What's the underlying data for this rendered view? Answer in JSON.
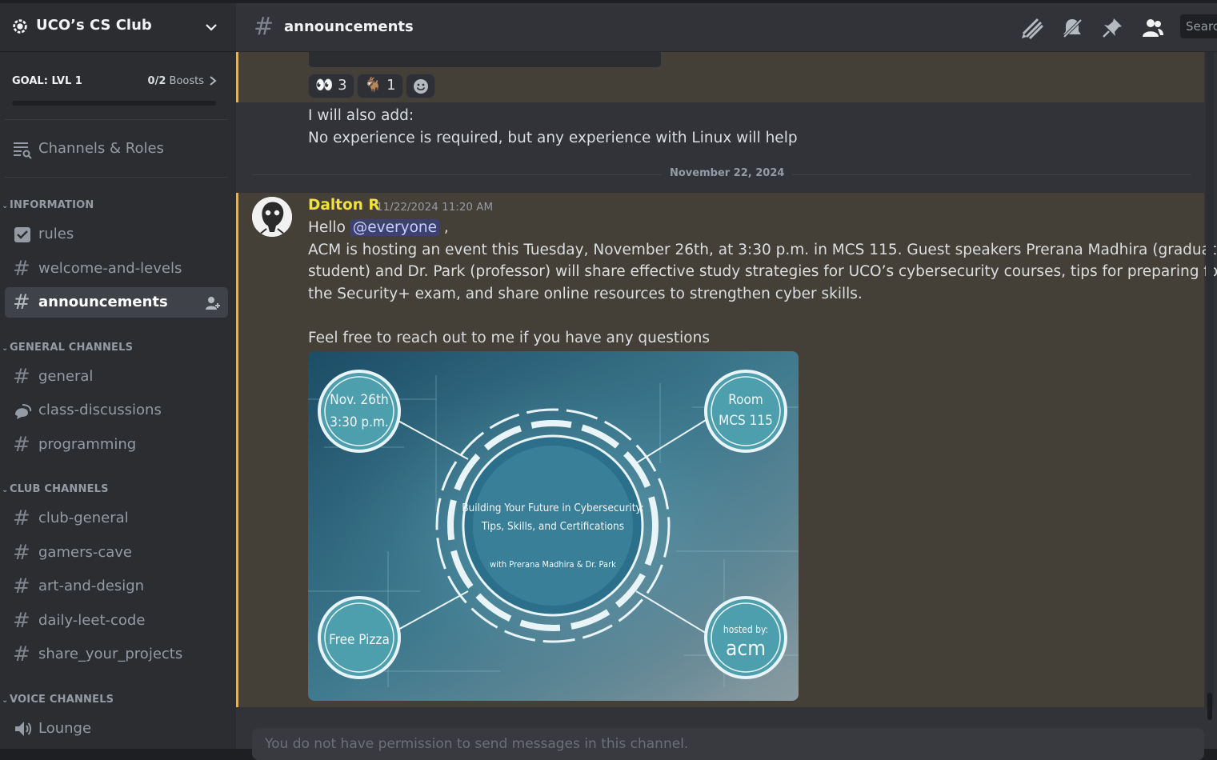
{
  "server": {
    "name": "UCO’s CS Club",
    "goal_label": "GOAL: LVL 1",
    "boosts_count": "0/2",
    "boosts_label": "Boosts",
    "progress": 0
  },
  "sidebar": {
    "channels_roles": "Channels & Roles",
    "categories": [
      {
        "label": "INFORMATION",
        "channels": [
          {
            "name": "rules",
            "icon": "rules-icon"
          },
          {
            "name": "welcome-and-levels",
            "icon": "hash-icon"
          },
          {
            "name": "announcements",
            "icon": "hash-icon",
            "active": true
          }
        ]
      },
      {
        "label": "GENERAL CHANNELS",
        "channels": [
          {
            "name": "general",
            "icon": "hash-icon"
          },
          {
            "name": "class-discussions",
            "icon": "forum-icon"
          },
          {
            "name": "programming",
            "icon": "hash-icon"
          }
        ]
      },
      {
        "label": "CLUB CHANNELS",
        "channels": [
          {
            "name": "club-general",
            "icon": "hash-icon"
          },
          {
            "name": "gamers-cave",
            "icon": "hash-icon"
          },
          {
            "name": "art-and-design",
            "icon": "hash-icon"
          },
          {
            "name": "daily-leet-code",
            "icon": "hash-icon"
          },
          {
            "name": "share_your_projects",
            "icon": "hash-icon"
          }
        ]
      },
      {
        "label": "VOICE CHANNELS",
        "channels": [
          {
            "name": "Lounge",
            "icon": "speaker-icon"
          }
        ]
      }
    ]
  },
  "header": {
    "channel": "announcements",
    "search_placeholder": "Search"
  },
  "messages": {
    "reactions": [
      {
        "emoji": "eyes",
        "count": "3"
      },
      {
        "emoji": "goat",
        "count": "1"
      }
    ],
    "prev_lines": [
      "I will also add:",
      "No experience is required, but any experience with Linux will help"
    ],
    "date_divider": "November 22, 2024",
    "post": {
      "author": "Dalton R",
      "timestamp": "11/22/2024 11:20 AM",
      "hello": "Hello",
      "mention": "@everyone",
      "comma": " ,",
      "line1": "ACM is hosting an event this Tuesday, November 26th, at 3:30 p.m. in MCS 115. Guest speakers Prerana Madhira (graduate",
      "line2": "student) and Dr. Park (professor) will share effective study strategies for UCO’s cybersecurity courses, tips for preparing for",
      "line3": "the Security+ exam, and share online resources to strengthen cyber skills.",
      "line4": "Feel free to reach out to me if you have any questions"
    },
    "poster": {
      "date": "Nov. 26th",
      "time": "3:30 p.m.",
      "room": "Room",
      "room_num": "MCS 115",
      "title1": "Building Your Future in Cybersecurity:",
      "title2": "Tips, Skills, and Certifications",
      "speakers": "with Prerana Madhira & Dr. Park",
      "pizza": "Free Pizza",
      "hosted": "hosted by:",
      "acm": "acm"
    },
    "input_placeholder": "You do not have permission to send messages in this channel."
  },
  "colors": {
    "accent_mention": "#3c4270",
    "highlight_border": "#f0b232",
    "author": "#f0e040"
  }
}
